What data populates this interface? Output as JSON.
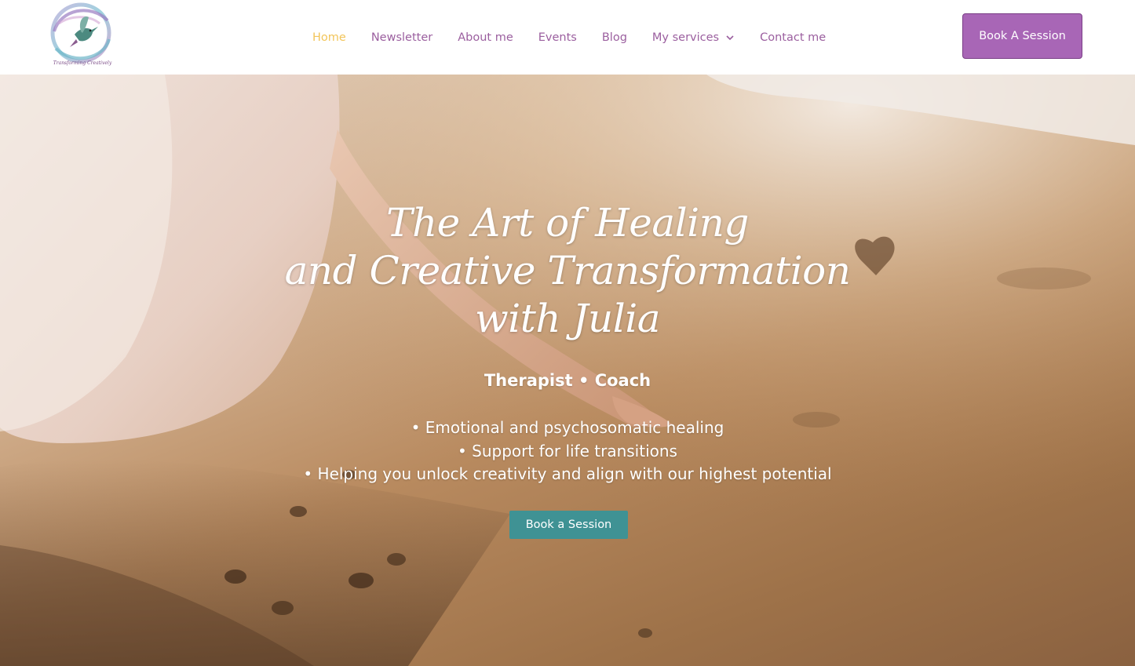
{
  "header": {
    "logo_icon": "hummingbird-logo",
    "logo_text": "Transforming Creatively",
    "nav": [
      {
        "label": "Home",
        "active": true
      },
      {
        "label": "Newsletter",
        "active": false
      },
      {
        "label": "About me",
        "active": false
      },
      {
        "label": "Events",
        "active": false
      },
      {
        "label": "Blog",
        "active": false
      },
      {
        "label": "My services",
        "active": false,
        "has_dropdown": true
      },
      {
        "label": "Contact me",
        "active": false
      }
    ],
    "cta_label": "Book A Session"
  },
  "hero": {
    "title_lines": [
      "The Art of Healing",
      "and Creative Transformation",
      "with Julia"
    ],
    "subtitle": "Therapist • Coach",
    "bullets": [
      "• Emotional and psychosomatic healing",
      "• Support for life transitions",
      "• Helping you unlock creativity and align with our highest potential"
    ],
    "cta_label": "Book a Session"
  },
  "colors": {
    "nav_text": "#9b5f9f",
    "nav_active": "#f2c55a",
    "cta_top_bg": "#a866b6",
    "cta_hero_bg": "#3f9294"
  }
}
